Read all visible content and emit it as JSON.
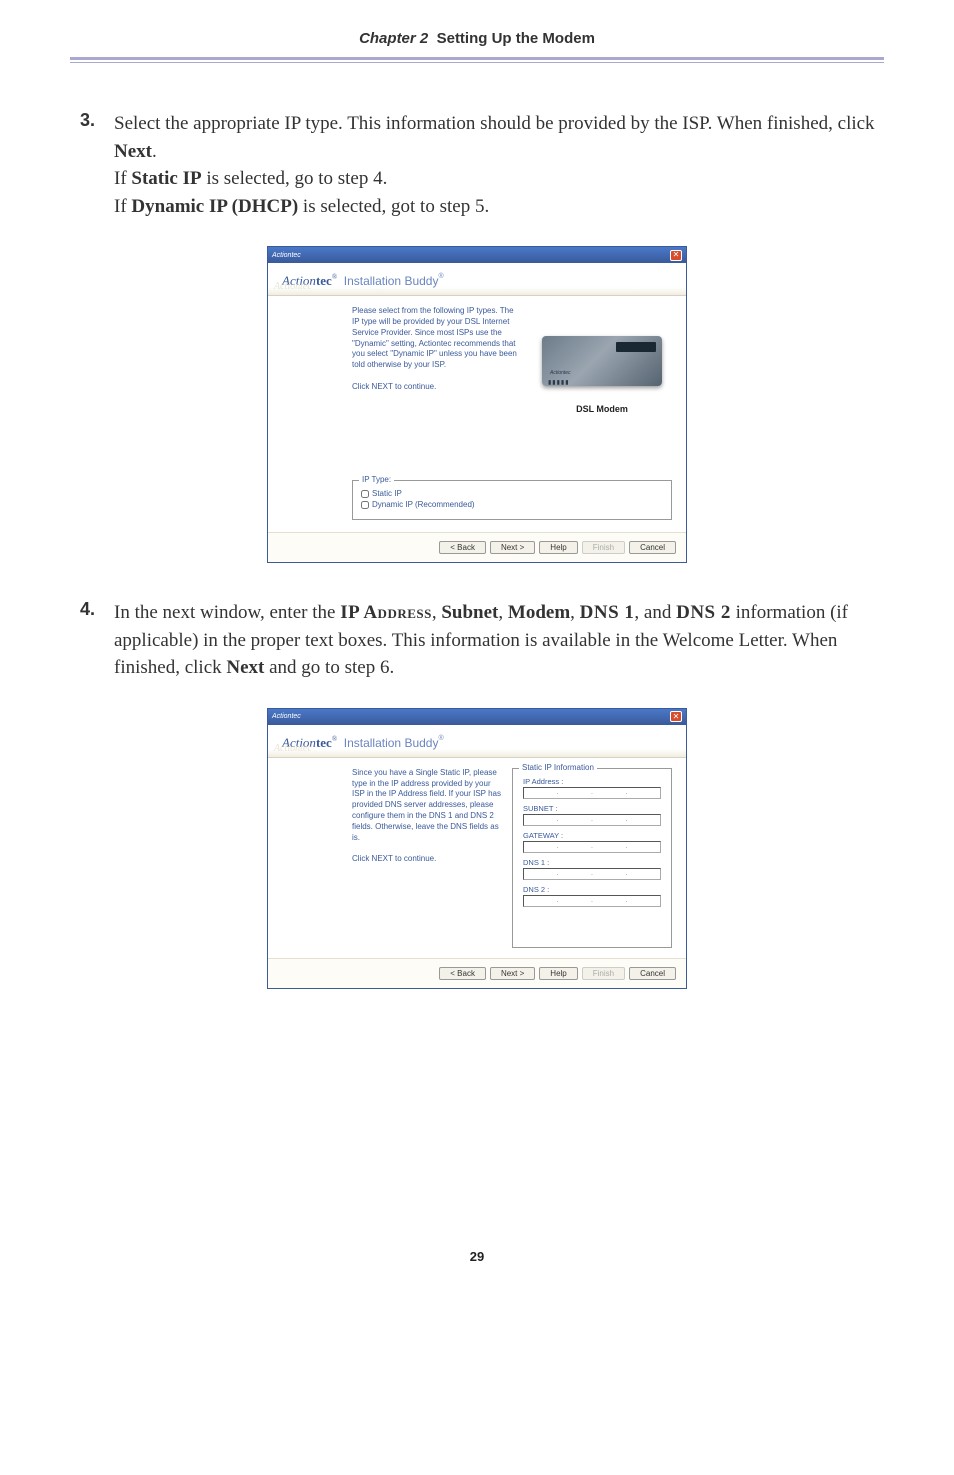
{
  "header": {
    "chapter_label": "Chapter 2",
    "chapter_title": "Setting Up the Modem"
  },
  "step3": {
    "num": "3.",
    "line1a": "Select the appropriate IP type. This information should be provided by the ISP. When finished, click ",
    "line1b": "Next",
    "line1c": ".",
    "line2a": "If ",
    "line2b": "Static IP",
    "line2c": " is selected, go to step 4.",
    "line3a": "If ",
    "line3b": "Dynamic IP (DHCP)",
    "line3c": " is selected, got to step 5."
  },
  "dialog1": {
    "titlebar": "Actiontec",
    "brand_script": "Action",
    "brand_bold": "tec",
    "brand_sub": "Installation Buddy",
    "reg": "®",
    "instructions": "Please select from the following IP types. The IP type will be provided by your DSL Internet Service Provider. Since most ISPs use the \"Dynamic\" setting, Actiontec recommends that you select \"Dynamic IP\" unless you have been told otherwise by your ISP.\n\nClick NEXT to continue.",
    "modem_brand": "Actiontec",
    "modem_overlay": "DSL Modem",
    "modem_caption": "DSL Modem",
    "modem_lights": "▮▮▮▮▮",
    "group_label": "IP Type:",
    "opt_static": "Static IP",
    "opt_dynamic": "Dynamic IP (Recommended)",
    "back": "< Back",
    "next": "Next >",
    "help": "Help",
    "finish": "Finish",
    "cancel": "Cancel"
  },
  "step4": {
    "num": "4.",
    "t1": "In the next window, enter the ",
    "ip_address": "IP Address",
    "t2": ", ",
    "subnet": "Subnet",
    "t3": ", ",
    "modem": "Modem",
    "t4": ", ",
    "dns1": "DNS 1",
    "t5": ", and ",
    "dns2": "DNS 2",
    "t6": " information (if applicable) in the proper text boxes. This information is available in the Welcome Letter. When finished, click ",
    "next": "Next",
    "t7": " and go to step 6."
  },
  "dialog2": {
    "titlebar": "Actiontec",
    "brand_script": "Action",
    "brand_bold": "tec",
    "brand_sub": "Installation Buddy",
    "reg": "®",
    "instructions": "Since you have a Single Static IP, please type in the IP address provided by your ISP in the IP Address field. If your ISP has provided DNS server addresses, please configure them in the DNS 1 and DNS 2 fields. Otherwise, leave the DNS fields as is.\n\nClick NEXT to continue.",
    "group_label": "Static IP Information",
    "fields": {
      "ip": "IP Address :",
      "subnet": "SUBNET :",
      "gateway": "GATEWAY :",
      "dns1": "DNS 1 :",
      "dns2": "DNS 2 :"
    },
    "back": "< Back",
    "next": "Next >",
    "help": "Help",
    "finish": "Finish",
    "cancel": "Cancel"
  },
  "footer": {
    "page": "29"
  }
}
